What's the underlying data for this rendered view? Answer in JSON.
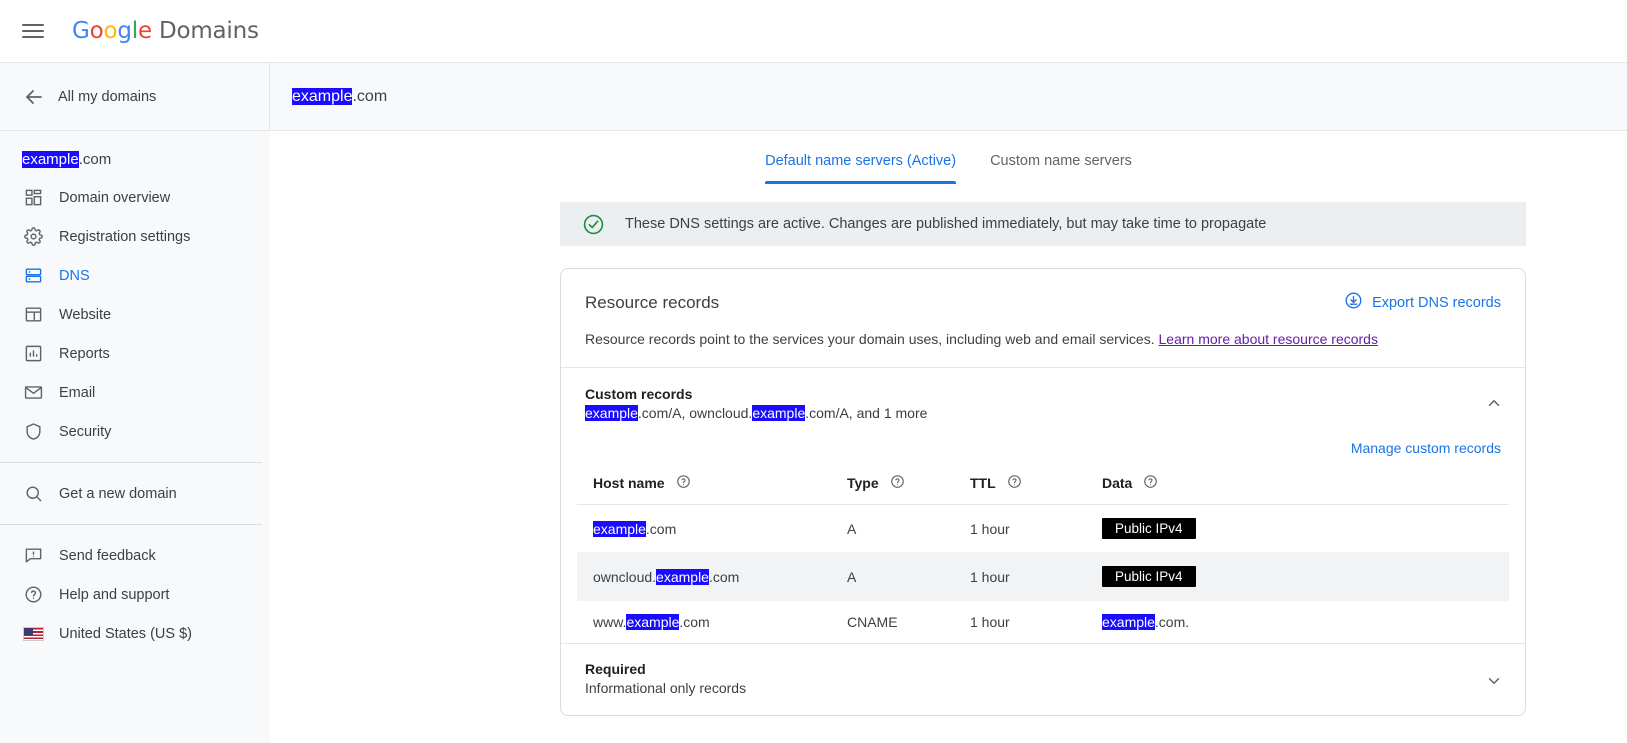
{
  "header": {
    "menu_icon": "hamburger-menu-icon",
    "logo": {
      "google": "Google",
      "product": "Domains"
    }
  },
  "subheader": {
    "back_icon": "arrow-left-icon",
    "back_label": "All my domains",
    "domain_selected": "example",
    "domain_suffix": ".com"
  },
  "sidebar": {
    "domain_selected": "example",
    "domain_suffix": ".com",
    "items": [
      {
        "label": "Domain overview",
        "icon": "dashboard-icon",
        "active": false
      },
      {
        "label": "Registration settings",
        "icon": "gear-icon",
        "active": false
      },
      {
        "label": "DNS",
        "icon": "dns-server-icon",
        "active": true
      },
      {
        "label": "Website",
        "icon": "website-layout-icon",
        "active": false
      },
      {
        "label": "Reports",
        "icon": "bar-chart-icon",
        "active": false
      },
      {
        "label": "Email",
        "icon": "envelope-icon",
        "active": false
      },
      {
        "label": "Security",
        "icon": "shield-icon",
        "active": false
      }
    ],
    "get_new_domain": {
      "label": "Get a new domain",
      "icon": "search-icon"
    },
    "footer_items": [
      {
        "label": "Send feedback",
        "icon": "feedback-icon"
      },
      {
        "label": "Help and support",
        "icon": "help-circle-icon"
      },
      {
        "label": "United States (US $)",
        "icon": "us-flag-icon"
      }
    ]
  },
  "main": {
    "tabs": [
      {
        "label": "Default name servers (Active)",
        "active": true
      },
      {
        "label": "Custom name servers",
        "active": false
      }
    ],
    "banner": {
      "icon": "check-circle-icon",
      "text": "These DNS settings are active. Changes are published immediately, but may take time to propagate"
    },
    "card": {
      "title": "Resource records",
      "export_label": "Export DNS records",
      "export_icon": "download-circle-icon",
      "description_prefix": "Resource records point to the services your domain uses, including web and email services. ",
      "description_link": "Learn more about resource records"
    },
    "custom_records": {
      "title": "Custom records",
      "summary_prefix": "",
      "summary_sel1": "example",
      "summary_mid": ".com/A, owncloud.",
      "summary_sel2": "example",
      "summary_suffix": ".com/A, and 1 more",
      "collapse_icon": "chevron-up-icon",
      "manage_link": "Manage custom records",
      "columns": [
        {
          "label": "Host name",
          "help_icon": "help-circle-icon"
        },
        {
          "label": "Type",
          "help_icon": "help-circle-icon"
        },
        {
          "label": "TTL",
          "help_icon": "help-circle-icon"
        },
        {
          "label": "Data",
          "help_icon": "help-circle-icon"
        }
      ],
      "rows": [
        {
          "host_prefix": "",
          "host_sel": "example",
          "host_suffix": ".com",
          "type": "A",
          "ttl": "1 hour",
          "data_kind": "redacted",
          "data_value": "Public IPv4",
          "data_prefix": "",
          "data_sel": "",
          "data_suffix": ""
        },
        {
          "host_prefix": "owncloud.",
          "host_sel": "example",
          "host_suffix": ".com",
          "type": "A",
          "ttl": "1 hour",
          "data_kind": "redacted",
          "data_value": "Public IPv4",
          "data_prefix": "",
          "data_sel": "",
          "data_suffix": ""
        },
        {
          "host_prefix": "www.",
          "host_sel": "example",
          "host_suffix": ".com",
          "type": "CNAME",
          "ttl": "1 hour",
          "data_kind": "text",
          "data_value": "",
          "data_prefix": "",
          "data_sel": "example",
          "data_suffix": ".com."
        }
      ]
    },
    "required_section": {
      "title": "Required",
      "subtitle": "Informational only records",
      "expand_icon": "chevron-down-icon"
    }
  },
  "colors": {
    "accent_blue": "#1a73e8",
    "selection_blue": "#1a0dff",
    "link_purple": "#681da8",
    "success_green": "#1e8e3e",
    "redact_black": "#000000"
  }
}
